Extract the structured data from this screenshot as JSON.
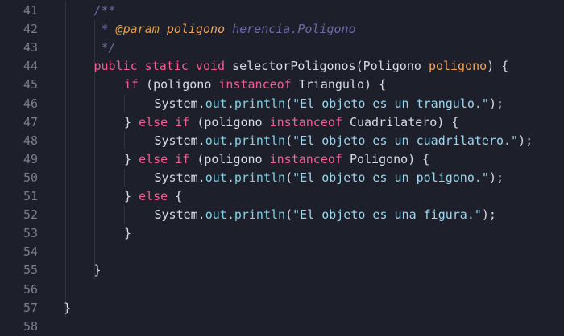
{
  "editor": {
    "language": "java",
    "lines": [
      {
        "num": "41",
        "indent": 1,
        "tokens": [
          {
            "t": "/**",
            "c": "cmt"
          }
        ]
      },
      {
        "num": "42",
        "indent": 1,
        "tokens": [
          {
            "t": " * ",
            "c": "cmt"
          },
          {
            "t": "@param",
            "c": "tag"
          },
          {
            "t": " ",
            "c": "cmt"
          },
          {
            "t": "poligono",
            "c": "param"
          },
          {
            "t": " herencia.Poligono",
            "c": "cmt"
          }
        ]
      },
      {
        "num": "43",
        "indent": 1,
        "tokens": [
          {
            "t": " */",
            "c": "cmt"
          }
        ]
      },
      {
        "num": "44",
        "indent": 1,
        "tokens": [
          {
            "t": "public static void ",
            "c": "kw"
          },
          {
            "t": "selectorPoligonos",
            "c": "obj"
          },
          {
            "t": "(",
            "c": "paren"
          },
          {
            "t": "Poligono ",
            "c": "obj"
          },
          {
            "t": "poligono",
            "c": "paramname"
          },
          {
            "t": ") {",
            "c": "paren"
          }
        ]
      },
      {
        "num": "45",
        "indent": 2,
        "tokens": [
          {
            "t": "if ",
            "c": "kw"
          },
          {
            "t": "(poligono ",
            "c": "obj"
          },
          {
            "t": "instanceof ",
            "c": "kw"
          },
          {
            "t": "Triangulo) {",
            "c": "obj"
          }
        ]
      },
      {
        "num": "46",
        "indent": 3,
        "tokens": [
          {
            "t": "System.",
            "c": "obj"
          },
          {
            "t": "out",
            "c": "field"
          },
          {
            "t": ".",
            "c": "obj"
          },
          {
            "t": "println",
            "c": "fn"
          },
          {
            "t": "(",
            "c": "obj"
          },
          {
            "t": "\"El objeto es un trangulo.\"",
            "c": "str"
          },
          {
            "t": ");",
            "c": "obj"
          }
        ]
      },
      {
        "num": "47",
        "indent": 2,
        "tokens": [
          {
            "t": "} ",
            "c": "obj"
          },
          {
            "t": "else if ",
            "c": "kw"
          },
          {
            "t": "(poligono ",
            "c": "obj"
          },
          {
            "t": "instanceof ",
            "c": "kw"
          },
          {
            "t": "Cuadrilatero) {",
            "c": "obj"
          }
        ]
      },
      {
        "num": "48",
        "indent": 3,
        "tokens": [
          {
            "t": "System.",
            "c": "obj"
          },
          {
            "t": "out",
            "c": "field"
          },
          {
            "t": ".",
            "c": "obj"
          },
          {
            "t": "println",
            "c": "fn"
          },
          {
            "t": "(",
            "c": "obj"
          },
          {
            "t": "\"El objeto es un cuadrilatero.\"",
            "c": "str"
          },
          {
            "t": ");",
            "c": "obj"
          }
        ]
      },
      {
        "num": "49",
        "indent": 2,
        "tokens": [
          {
            "t": "} ",
            "c": "obj"
          },
          {
            "t": "else if ",
            "c": "kw"
          },
          {
            "t": "(poligono ",
            "c": "obj"
          },
          {
            "t": "instanceof ",
            "c": "kw"
          },
          {
            "t": "Poligono) {",
            "c": "obj"
          }
        ]
      },
      {
        "num": "50",
        "indent": 3,
        "tokens": [
          {
            "t": "System.",
            "c": "obj"
          },
          {
            "t": "out",
            "c": "field"
          },
          {
            "t": ".",
            "c": "obj"
          },
          {
            "t": "println",
            "c": "fn"
          },
          {
            "t": "(",
            "c": "obj"
          },
          {
            "t": "\"El objeto es un poligono.\"",
            "c": "str"
          },
          {
            "t": ");",
            "c": "obj"
          }
        ]
      },
      {
        "num": "51",
        "indent": 2,
        "tokens": [
          {
            "t": "} ",
            "c": "obj"
          },
          {
            "t": "else ",
            "c": "kw"
          },
          {
            "t": "{",
            "c": "obj"
          }
        ]
      },
      {
        "num": "52",
        "indent": 3,
        "tokens": [
          {
            "t": "System.",
            "c": "obj"
          },
          {
            "t": "out",
            "c": "field"
          },
          {
            "t": ".",
            "c": "obj"
          },
          {
            "t": "println",
            "c": "fn"
          },
          {
            "t": "(",
            "c": "obj"
          },
          {
            "t": "\"El objeto es una figura.\"",
            "c": "str"
          },
          {
            "t": ");",
            "c": "obj"
          }
        ]
      },
      {
        "num": "53",
        "indent": 2,
        "tokens": [
          {
            "t": "}",
            "c": "obj"
          }
        ]
      },
      {
        "num": "54",
        "indent": 0,
        "tokens": []
      },
      {
        "num": "55",
        "indent": 1,
        "tokens": [
          {
            "t": "}",
            "c": "obj"
          }
        ]
      },
      {
        "num": "56",
        "indent": 0,
        "tokens": []
      },
      {
        "num": "57",
        "indent": 0,
        "tokens": [
          {
            "t": "}",
            "c": "obj"
          }
        ]
      },
      {
        "num": "58",
        "indent": 0,
        "tokens": []
      }
    ]
  }
}
